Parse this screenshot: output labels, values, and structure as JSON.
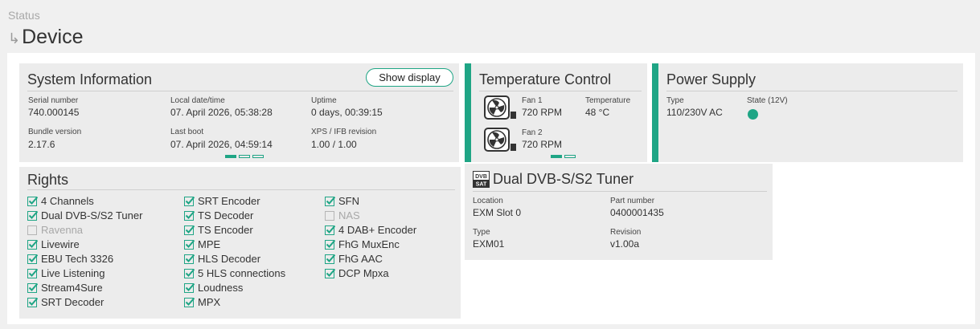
{
  "breadcrumb": "Status",
  "page_title": "Device",
  "accent_color": "#1fa585",
  "system_info": {
    "title": "System Information",
    "show_display_label": "Show display",
    "fields": [
      {
        "label": "Serial number",
        "value": "740.000145"
      },
      {
        "label": "Local date/time",
        "value": "07. April 2026, 05:38:28"
      },
      {
        "label": "Uptime",
        "value": "0 days, 00:39:15"
      },
      {
        "label": "Bundle version",
        "value": "2.17.6"
      },
      {
        "label": "Last boot",
        "value": "07. April 2026, 04:59:14"
      },
      {
        "label": "XPS / IFB revision",
        "value": "1.00 / 1.00"
      }
    ],
    "pager": {
      "pages": 3,
      "active": 1
    }
  },
  "temperature": {
    "title": "Temperature Control",
    "fans": [
      {
        "icon": "fan-icon",
        "label": "Fan 1",
        "value": "720 RPM"
      },
      {
        "icon": "fan-icon",
        "label": "Fan 2",
        "value": "720 RPM"
      }
    ],
    "temp_label": "Temperature",
    "temp_value": "48 °C",
    "pager": {
      "pages": 2,
      "active": 1
    }
  },
  "power": {
    "title": "Power Supply",
    "type_label": "Type",
    "type_value": "110/230V AC",
    "state_label": "State (12V)",
    "state_color": "#1fa585"
  },
  "rights": {
    "title": "Rights",
    "columns": [
      [
        {
          "label": "4 Channels",
          "checked": true
        },
        {
          "label": "Dual DVB-S/S2 Tuner",
          "checked": true
        },
        {
          "label": "Ravenna",
          "checked": false
        },
        {
          "label": "Livewire",
          "checked": true
        },
        {
          "label": "EBU Tech 3326",
          "checked": true
        },
        {
          "label": "Live Listening",
          "checked": true
        },
        {
          "label": "Stream4Sure",
          "checked": true
        },
        {
          "label": "SRT Decoder",
          "checked": true
        }
      ],
      [
        {
          "label": "SRT Encoder",
          "checked": true
        },
        {
          "label": "TS Decoder",
          "checked": true
        },
        {
          "label": "TS Encoder",
          "checked": true
        },
        {
          "label": "MPE",
          "checked": true
        },
        {
          "label": "HLS Decoder",
          "checked": true
        },
        {
          "label": "5 HLS connections",
          "checked": true
        },
        {
          "label": "Loudness",
          "checked": true
        },
        {
          "label": "MPX",
          "checked": true
        }
      ],
      [
        {
          "label": "SFN",
          "checked": true
        },
        {
          "label": "NAS",
          "checked": false
        },
        {
          "label": "4 DAB+ Encoder",
          "checked": true
        },
        {
          "label": "FhG MuxEnc",
          "checked": true
        },
        {
          "label": "FhG AAC",
          "checked": true
        },
        {
          "label": "DCP Mpxa",
          "checked": true
        }
      ]
    ]
  },
  "tuner": {
    "icon": "dvb-sat-icon",
    "icon_text_top": "DVB",
    "icon_text_bottom": "SAT",
    "title": "Dual DVB-S/S2 Tuner",
    "fields": [
      {
        "label": "Location",
        "value": "EXM Slot 0"
      },
      {
        "label": "Part number",
        "value": "0400001435"
      },
      {
        "label": "Type",
        "value": "EXM01"
      },
      {
        "label": "Revision",
        "value": "v1.00a"
      }
    ]
  }
}
